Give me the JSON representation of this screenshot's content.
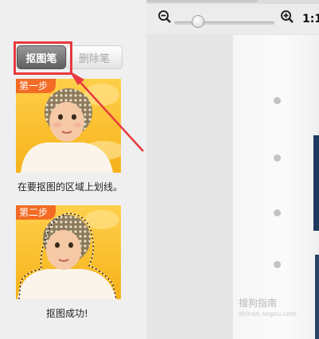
{
  "tools": {
    "matting_pen_label": "抠图笔",
    "erase_pen_label": "删除笔"
  },
  "steps": [
    {
      "tag": "第一步",
      "caption": "在要抠图的区域上划线。"
    },
    {
      "tag": "第二步",
      "caption": "抠图成功!"
    }
  ],
  "zoom": {
    "actual_size_label": "1:1"
  },
  "watermark": {
    "brand": "搜狗指南",
    "url": "zhinan.sogou.com"
  },
  "colors": {
    "highlight": "#e8393f",
    "step_tag": "#f36b25"
  }
}
